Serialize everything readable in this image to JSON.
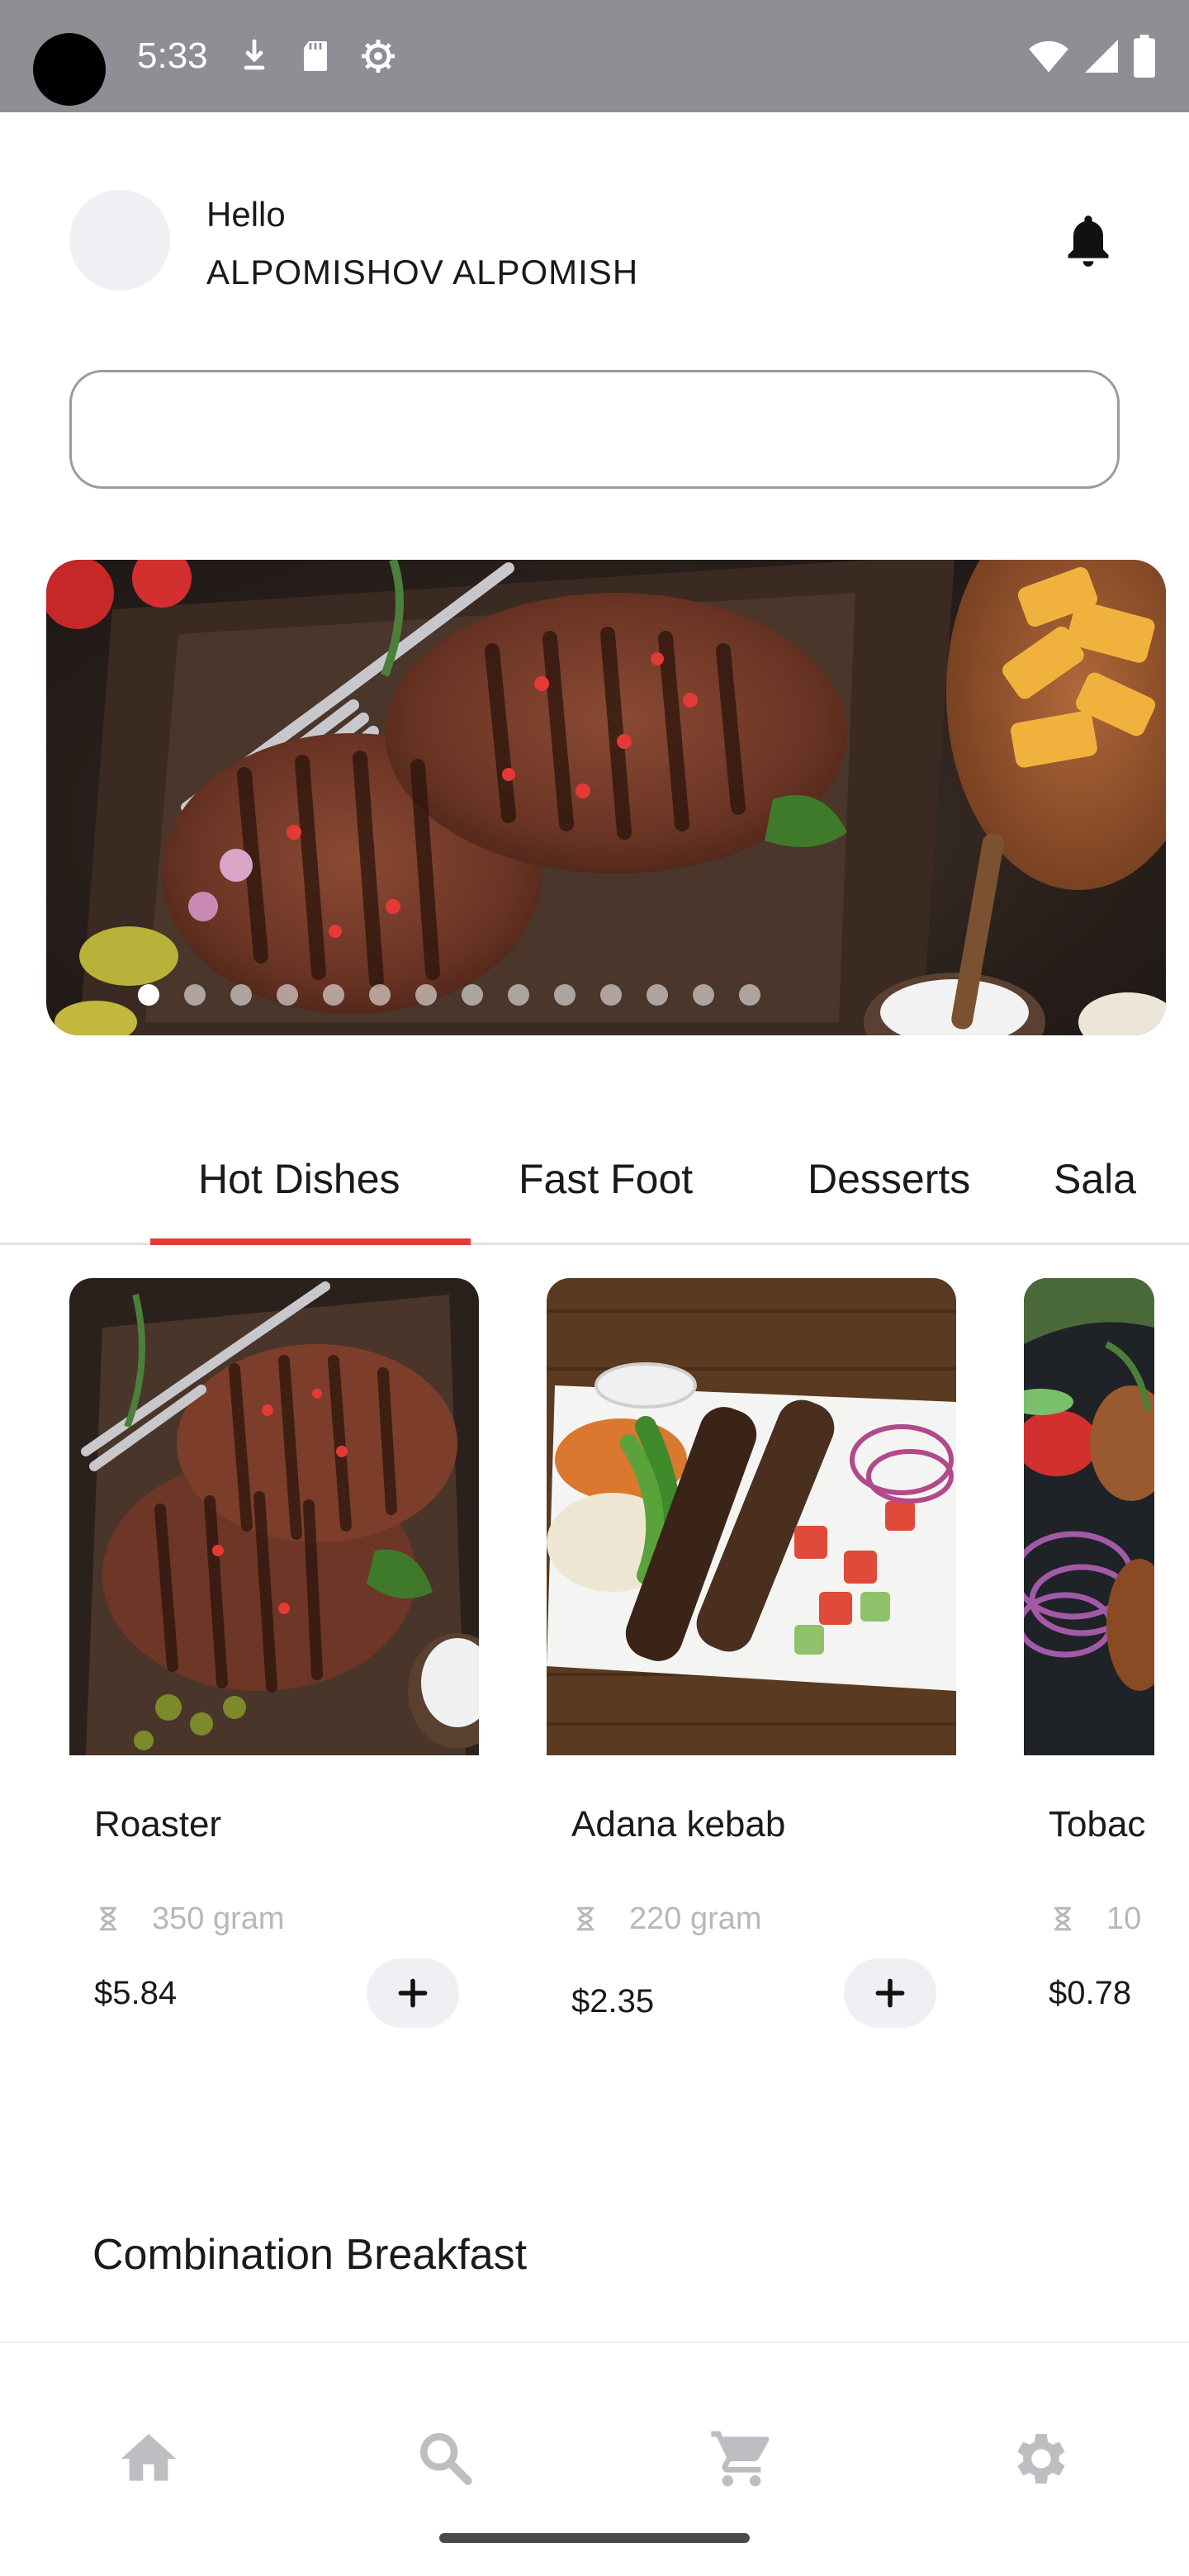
{
  "status_bar": {
    "time": "5:33",
    "icons_left": [
      "download-icon",
      "sd-card-icon",
      "settings-gear-icon"
    ],
    "icons_right": [
      "wifi-icon",
      "signal-icon",
      "battery-icon"
    ],
    "bg_color": "#8e8e94"
  },
  "header": {
    "greeting": "Hello",
    "username": "ALPOMISHOV ALPOMISH",
    "notification_icon": "bell-icon"
  },
  "search": {
    "value": "",
    "placeholder": ""
  },
  "banner": {
    "image": "grilled steak on wooden board with fork, fries and herbs",
    "page_count": 14,
    "active_index": 0
  },
  "tabs": [
    {
      "label": "Hot Dishes",
      "active": true
    },
    {
      "label": "Fast Foot",
      "active": false
    },
    {
      "label": "Desserts",
      "active": false
    },
    {
      "label": "Sala",
      "active": false
    }
  ],
  "accent_color": "#e53935",
  "products": [
    {
      "name": "Roaster",
      "weight": "350 gram",
      "price": "$5.84",
      "image": "grilled steaks with peppercorns"
    },
    {
      "name": "Adana kebab",
      "weight": "220 gram",
      "price": "$2.35",
      "image": "adana kebab plate with rice and salad"
    },
    {
      "name": "Tobac",
      "weight": "10",
      "price": "$0.78",
      "image": "salad with red onion and tomato"
    }
  ],
  "section": {
    "title": "Combination Breakfast"
  },
  "bottom_nav": [
    {
      "icon": "home-icon"
    },
    {
      "icon": "search-icon"
    },
    {
      "icon": "cart-icon"
    },
    {
      "icon": "settings-icon"
    }
  ]
}
